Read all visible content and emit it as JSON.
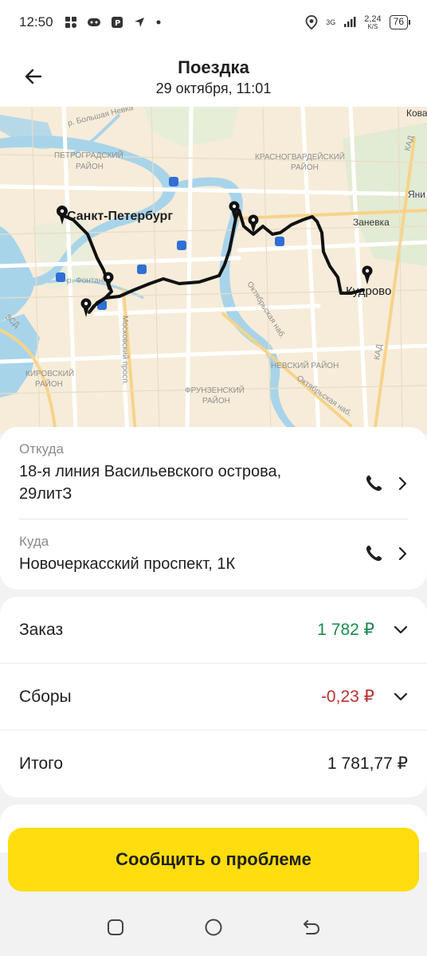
{
  "status_bar": {
    "time": "12:50",
    "network_type": "3G",
    "data_speed_value": "2,24",
    "data_speed_unit": "K/S",
    "battery": "76"
  },
  "header": {
    "title": "Поездка",
    "subtitle": "29 октября, 11:01"
  },
  "map": {
    "labels": {
      "city": "Санкт-Петербург",
      "petrogradsky": "ПЕТРОГРАДСКИЙ",
      "rayon": "РАЙОН",
      "krasnogvardeysky": "КРАСНОГВАРДЕЙСКИЙ",
      "zanevka": "Заневка",
      "kudrovo": "Кудрово",
      "nevsky": "НЕВСКИЙ РАЙОН",
      "frunzensky": "ФРУНЗЕНСКИЙ",
      "kirovsky": "КИРОВСКИЙ",
      "moskovsky": "Московский просп.",
      "oktyabrskaya": "Октябрьская наб.",
      "b_nevka": "р. Большая Невка",
      "fontanka": "р. Фонтанка",
      "kad": "КАД",
      "kova": "Кова",
      "yani": "Яни",
      "zsd": "ЗСД"
    }
  },
  "from": {
    "label": "Откуда",
    "address_line1": "18-я линия Васильевского острова,",
    "address_line2": "29литЗ"
  },
  "to": {
    "label": "Куда",
    "address": "Новочеркасский проспект, 1К"
  },
  "pricing": {
    "order_label": "Заказ",
    "order_amount": "1 782 ₽",
    "fees_label": "Сборы",
    "fees_amount": "-0,23 ₽",
    "total_label": "Итого",
    "total_amount": "1 781,77 ₽"
  },
  "cta": {
    "label": "Сообщить о проблеме"
  },
  "colors": {
    "accent_yellow": "#ffdd0f",
    "positive_green": "#1b8a4e",
    "negative_red": "#b8312f"
  },
  "icons": [
    "back-arrow-icon",
    "phone-icon",
    "chevron-right-icon",
    "chevron-down-icon",
    "map-pin-icon"
  ]
}
